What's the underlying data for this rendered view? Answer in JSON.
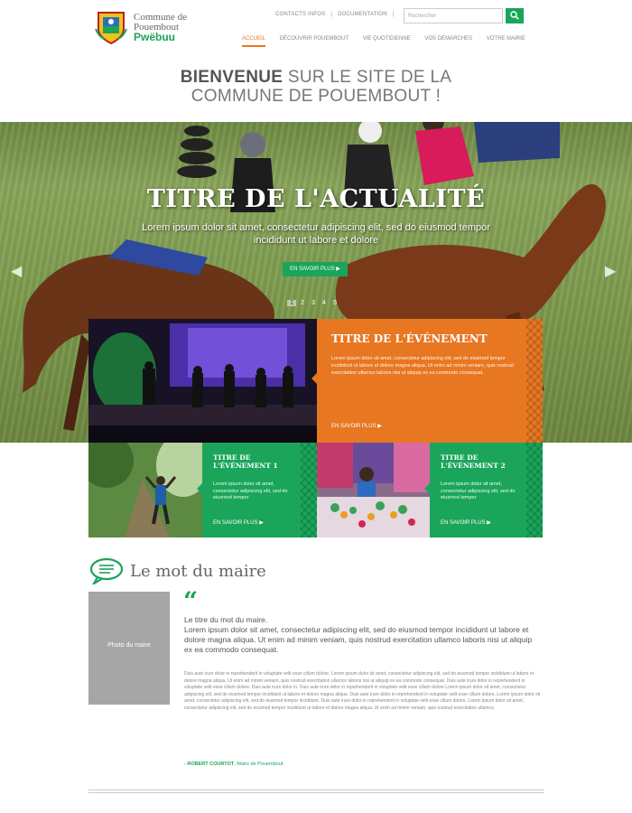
{
  "header": {
    "logo_line1": "Commune de",
    "logo_line2": "Pouembout",
    "logo_line3": "Pwëbuu",
    "toplinks": [
      "CONTACTS INFOS",
      "DOCUMENTATION"
    ],
    "search_placeholder": "Rechercher",
    "nav": [
      "ACCUEIL",
      "DÉCOUVRIR POUEMBOUT",
      "VIE QUOTIDIENNE",
      "VOS DÉMARCHES",
      "VOTRE MAIRIE"
    ],
    "active_nav": "ACCUEIL",
    "accent_color": "#e87722",
    "brand_color": "#1aa55a"
  },
  "welcome": {
    "bold": "BIENVENUE",
    "rest_line1": " SUR LE SITE DE LA",
    "line2": "COMMUNE DE POUEMBOUT !"
  },
  "hero": {
    "title": "TITRE DE L'ACTUALITÉ",
    "subtitle": "Lorem ipsum dolor sit amet, consectetur adipiscing elit, sed do eiusmod tempor incididunt ut labore et dolore",
    "button": "EN SAVOIR PLUS ▶",
    "prev_icon": "◀",
    "next_icon": "▶",
    "dots": [
      "1",
      "2",
      "3",
      "4",
      "5"
    ],
    "active_dot": "1"
  },
  "events": {
    "main": {
      "title": "TITRE DE L'ÉVÉNEMENT",
      "text": "Lorem ipsum dolor sit amet, consectetur adipiscing elit, sed do eiusmod tempor incididunt ut labore et dolore magna aliqua. Ut enim ad minim veniam, quis nostrud exercitation ullamco laboris nisi ut aliquip ex ea commodo consequat.",
      "more": "EN SAVOIR PLUS ▶"
    },
    "one": {
      "title": "TITRE DE L'ÉVÉNEMENT 1",
      "text": "Lorem ipsum dolor sit amet, consectetur adipiscing elit, sed do eiusmod tempor",
      "more": "EN SAVOIR PLUS ▶"
    },
    "two": {
      "title": "TITRE DE L'ÉVÉNEMENT 2",
      "text": "Lorem ipsum dolor sit amet, consectetur adipiscing elit, sed do eiusmod tempor",
      "more": "EN SAVOIR PLUS ▶"
    }
  },
  "maire": {
    "section_title": "Le mot du maire",
    "photo_label": "Photo du maire",
    "quote_mark": "“",
    "heading": "Le titre du mot du maire.",
    "lead": "Lorem ipsum dolor sit amet, consectetur adipiscing elit, sed do eiusmod tempor incididunt ut labore et dolore magna aliqua. Ut enim ad minim veniam, quis nostrud exercitation ullamco laboris nisi ut aliquip ex ea commodo consequat.",
    "body": "Duis aute irure dolor in reprehenderit in voluptate velit esse cillum dolore. Lorem ipsum dolor sit amet, consectetur adipiscing elit, sed do eiusmod tempor incididunt ut labore et dolore magna aliqua. Ut enim ad minim veniam, quis nostrud exercitation ullamco laboris nisi ut aliquip ex ea commodo consequat. Duis aute irure dolor in reprehenderit in voluptate velit esse cillum dolore. Duis aute irure dolor in. Duis aute irure dolor in reprehenderit in voluptate velit esse cillum dolore Lorem ipsum dolor sit amet, consectetur adipiscing elit, sed do eiusmod tempor incididunt ut labore et dolore magna aliqua. Duis aute irure dolor in reprehenderit in voluptate velit esse cillum dolore. Lorem ipsum dolor sit amet, consectetur adipiscing elit, sed do eiusmod tempor incididunt. Duis aute irure dolor in reprehenderit in voluptate velit esse cillum dolore. Lorem ipsum dolor sit amet, consectetur adipiscing elit, sed do eiusmod tempor incididunt ut labore et dolore magna aliqua. Ut enim ad minim veniam, quis nostrud exercitation ullamco.",
    "signature_name": "- ROBERT COURTOT",
    "signature_role": ", Maire de Pouembout."
  }
}
